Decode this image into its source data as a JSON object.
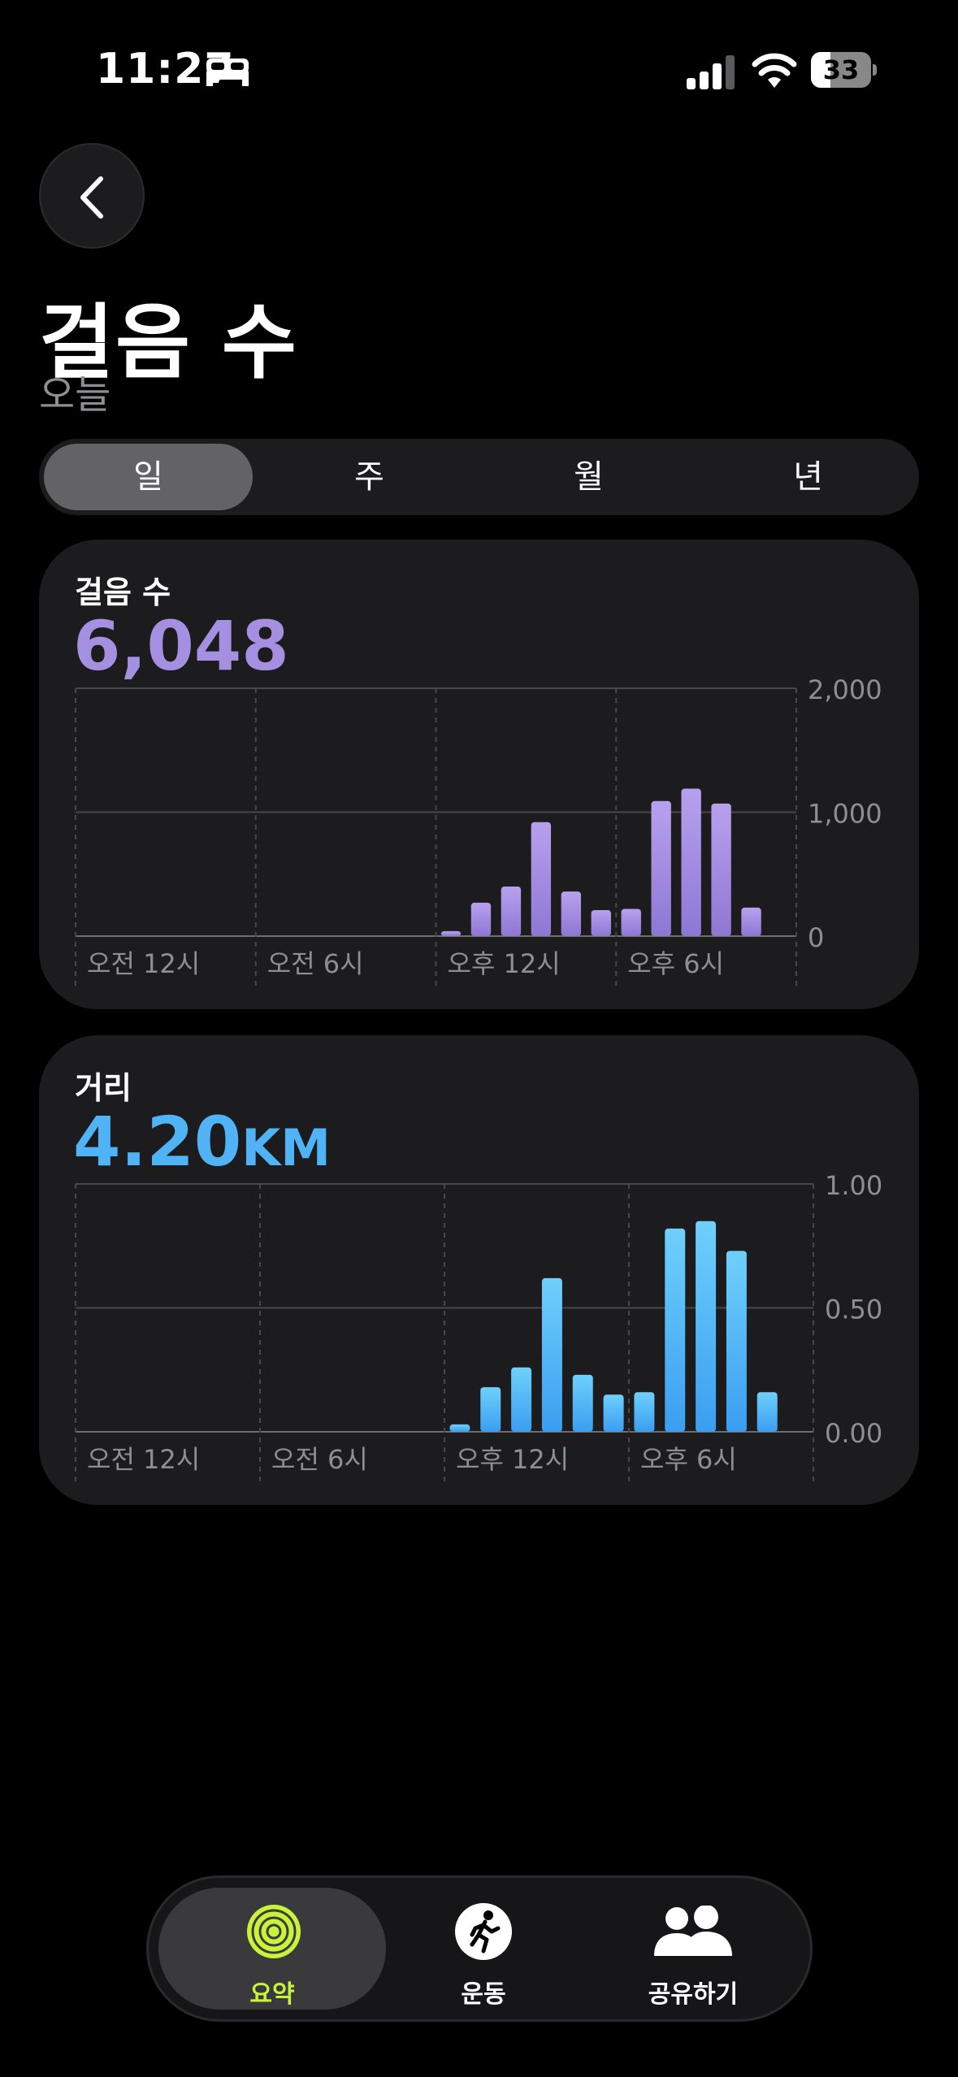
{
  "status_bar": {
    "time": "11:27",
    "battery_percent": "33",
    "battery_level": 0.33,
    "icons": [
      "sleep-focus-icon",
      "signal-icon",
      "wifi-icon",
      "battery-icon"
    ]
  },
  "header": {
    "back_icon": "chevron-left-icon",
    "title": "걸음 수",
    "subtitle": "오늘"
  },
  "segments": {
    "items": [
      {
        "label": "일",
        "selected": true
      },
      {
        "label": "주",
        "selected": false
      },
      {
        "label": "월",
        "selected": false
      },
      {
        "label": "년",
        "selected": false
      }
    ]
  },
  "steps_card": {
    "label": "걸음 수",
    "value": "6,048",
    "accent": "#a48fe0"
  },
  "distance_card": {
    "label": "거리",
    "value": "4.20",
    "unit": "KM",
    "accent": "#4fb3f6"
  },
  "chart_data": [
    {
      "type": "bar",
      "x_labels": [
        "오전 12시",
        "오전 6시",
        "오후 12시",
        "오후 6시"
      ],
      "hours": [
        12,
        13,
        14,
        15,
        16,
        17,
        18,
        19,
        20,
        21,
        22,
        23
      ],
      "values": [
        40,
        270,
        400,
        920,
        360,
        210,
        220,
        1090,
        1190,
        1070,
        230,
        0
      ],
      "y_ticks": [
        "2,000",
        "1,000",
        "0"
      ],
      "ylim": [
        0,
        2000
      ],
      "grid": true
    },
    {
      "type": "bar",
      "x_labels": [
        "오전 12시",
        "오전 6시",
        "오후 12시",
        "오후 6시"
      ],
      "hours": [
        12,
        13,
        14,
        15,
        16,
        17,
        18,
        19,
        20,
        21,
        22,
        23
      ],
      "values": [
        0.03,
        0.18,
        0.26,
        0.62,
        0.23,
        0.15,
        0.16,
        0.82,
        0.85,
        0.73,
        0.16,
        0
      ],
      "y_ticks": [
        "1.00",
        "0.50",
        "0.00"
      ],
      "ylim": [
        0,
        1
      ],
      "grid": true
    }
  ],
  "tab_bar": {
    "items": [
      {
        "label": "요약",
        "icon": "activity-rings-icon",
        "selected": true,
        "color": "#c9f33a"
      },
      {
        "label": "운동",
        "icon": "running-figure-icon",
        "selected": false,
        "color": "#ffffff"
      },
      {
        "label": "공유하기",
        "icon": "people-icon",
        "selected": false,
        "color": "#ffffff"
      }
    ]
  }
}
